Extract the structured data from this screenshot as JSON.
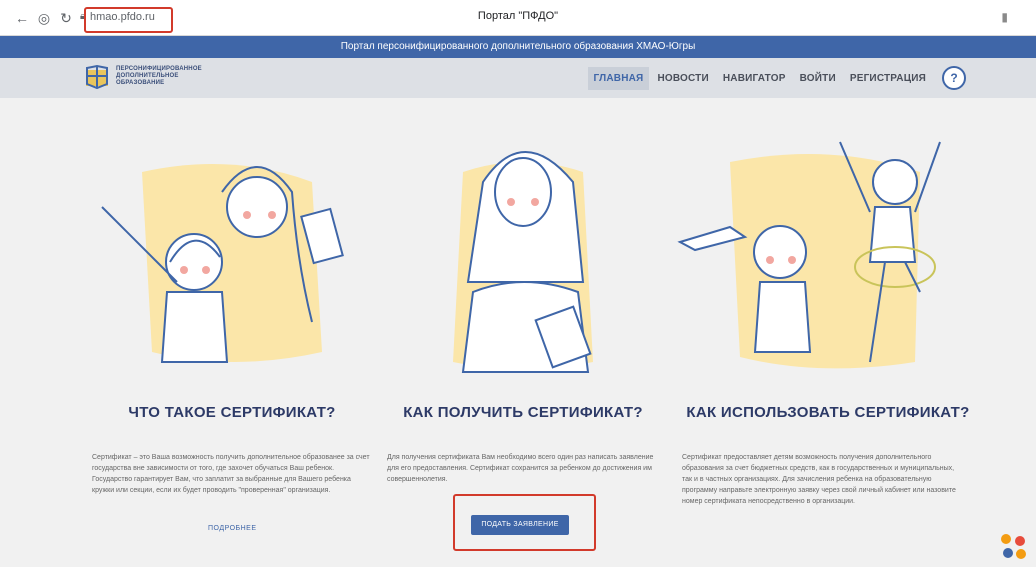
{
  "browser": {
    "back_icon": "arrow-left-icon",
    "info_icon": "info-icon",
    "reload_icon": "reload-icon",
    "lock_icon": "lock-icon",
    "address": "hmao.pfdo.ru",
    "tab_title": "Портал \"ПФДО\""
  },
  "banner": {
    "text": "Портал персонифицированного дополнительного образования ХМАО-Югры"
  },
  "header": {
    "logo_lines": [
      "ПЕРСОНИФИЦИРОВАННОЕ",
      "ДОПОЛНИТЕЛЬНОЕ",
      "ОБРАЗОВАНИЕ"
    ],
    "nav": [
      "ГЛАВНАЯ",
      "НОВОСТИ",
      "НАВИГАТОР",
      "ВОЙТИ",
      "РЕГИСТРАЦИЯ"
    ],
    "active_nav": "ГЛАВНАЯ",
    "help": "?"
  },
  "sections": [
    {
      "title": "ЧТО ТАКОЕ СЕРТИФИКАТ?",
      "text": "Сертификат – это Ваша возможность получить дополнительное образованее за счет государства вне зависимости от того, где захочет обучаться Ваш ребенок. Государство гарантирует Вам, что заплатит за выбранные для Вашего ребенка кружки или секции, если их будет проводить \"проверенная\" организация.",
      "link": "ПОДРОБНЕЕ"
    },
    {
      "title": "КАК ПОЛУЧИТЬ СЕРТИФИКАТ?",
      "text": "Для получения сертификата Вам необходимо всего один раз написать заявление для его предоставления. Сертификат сохранится за ребенком до достижения им совершеннолетия.",
      "button": "ПОДАТЬ ЗАЯВЛЕНИЕ"
    },
    {
      "title": "КАК ИСПОЛЬЗОВАТЬ СЕРТИФИКАТ?",
      "text": "Сертификат предоставляет детям возможность получения дополнительного образования за счет бюджетных средств, как в государственных и муниципальных, так и в частных организациях. Для зачисления ребенка на образовательную программу направьте электронную заявку через свой личный кабинет или назовите номер сертификата непосредственно в организации."
    }
  ],
  "colors": {
    "brand": "#3f66a8",
    "title": "#2d3a67",
    "highlight": "#d23a2b",
    "illus_bg": "#fbe6a9"
  }
}
